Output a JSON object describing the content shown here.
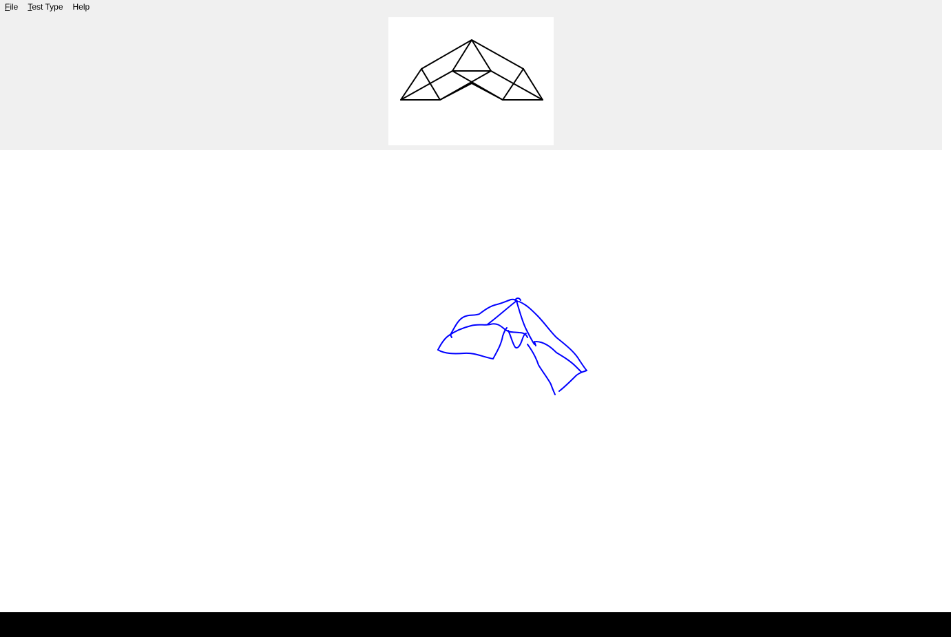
{
  "menu": {
    "file": {
      "mnemonic": "F",
      "rest": "ile"
    },
    "test_type": {
      "mnemonic": "T",
      "rest": "est Type"
    },
    "help": {
      "mnemonic": "",
      "rest": "Help"
    }
  },
  "colors": {
    "header_bg": "#f0f0f0",
    "target_stroke": "#000000",
    "drawing_stroke": "#0000ff"
  }
}
